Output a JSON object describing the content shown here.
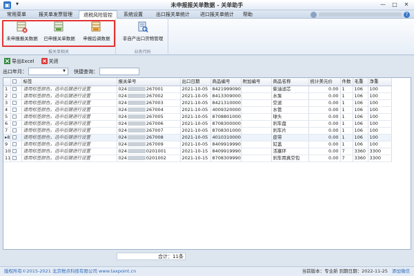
{
  "window": {
    "title": "未申报报关单数据 - 关单助手",
    "quick_access": "▾",
    "buttons": {
      "minimize": "—",
      "maximize": "□",
      "close": "✕"
    }
  },
  "menu": {
    "items": [
      "常用菜单",
      "报关单发票管理",
      "退税风险管控",
      "系统设置",
      "出口报关单统计",
      "进口报关单统计",
      "帮助"
    ],
    "active_index": 2,
    "help_glyph": "?"
  },
  "ribbon": {
    "group1": {
      "label": "报关单相关",
      "buttons": [
        {
          "label": "未申报报关数据",
          "icon": "grid-x-icon"
        },
        {
          "label": "已申报关单数据",
          "icon": "grid-check-icon"
        },
        {
          "label": "申报后调数据",
          "icon": "grid-return-icon"
        }
      ]
    },
    "group2": {
      "label": "业务代码",
      "buttons": [
        {
          "label": "非自产出口货物管理",
          "icon": "search-doc-icon"
        }
      ]
    }
  },
  "toolbar": {
    "export_label": "导出Excel",
    "close_label": "关闭"
  },
  "filter": {
    "month_label": "出口年月：",
    "month_value": "",
    "query_label": "快捷查询：",
    "query_value": ""
  },
  "table": {
    "columns": [
      "",
      "",
      "标签",
      "报关单号",
      "出口日期",
      "商品编号",
      "附加编号",
      "商品名称",
      "统计美元价",
      "件数",
      "毛重",
      "净重"
    ],
    "rows": [
      [
        "1",
        "",
        "请用标签颜色，选中后键进行设置",
        "024",
        "267001",
        "2021-10-05",
        "8421999090",
        "",
        "柴油滤芯",
        "0.00",
        "1",
        "106",
        "100"
      ],
      [
        "2",
        "",
        "请用标签颜色，选中后键进行设置",
        "024",
        "267002",
        "2021-10-05",
        "8413309000",
        "",
        "水泵",
        "0.00",
        "1",
        "106",
        "100"
      ],
      [
        "3",
        "",
        "请用标签颜色，选中后键进行设置",
        "024",
        "267003",
        "2021-10-05",
        "8421310000",
        "",
        "空滤",
        "0.00",
        "1",
        "106",
        "100"
      ],
      [
        "4",
        "",
        "请用标签颜色，选中后键进行设置",
        "024",
        "267004",
        "2021-10-05",
        "4009320000",
        "",
        "水管",
        "0.00",
        "1",
        "106",
        "100"
      ],
      [
        "5",
        "",
        "请用标签颜色，选中后键进行设置",
        "024",
        "267005",
        "2021-10-05",
        "8708801000",
        "",
        "球头",
        "0.00",
        "1",
        "106",
        "100"
      ],
      [
        "6",
        "",
        "请用标签颜色，选中后键进行设置",
        "024",
        "267006",
        "2021-10-05",
        "8708300000",
        "",
        "刹车盘",
        "0.00",
        "1",
        "106",
        "100"
      ],
      [
        "7",
        "",
        "请用标签颜色，选中后键进行设置",
        "024",
        "267007",
        "2021-10-05",
        "8708301000",
        "",
        "刹车片",
        "0.00",
        "1",
        "106",
        "100"
      ],
      [
        "8",
        "",
        "请用标签颜色，选中后键进行设置",
        "024",
        "267008",
        "2021-10-05",
        "4010310000",
        "",
        "皮带",
        "0.00",
        "1",
        "106",
        "100"
      ],
      [
        "9",
        "",
        "请用标签颜色，选中后键进行设置",
        "024",
        "267009",
        "2021-10-05",
        "8409919990",
        "",
        "缸盖",
        "0.00",
        "1",
        "106",
        "100"
      ],
      [
        "10",
        "",
        "请用标签颜色，选中后键进行设置",
        "024",
        "0201001",
        "2021-10-15",
        "8409919990",
        "",
        "活塞环",
        "0.00",
        "7",
        "3360",
        "3300"
      ],
      [
        "11",
        "",
        "请用标签颜色，选中后键进行设置",
        "024",
        "0201002",
        "2021-10-15",
        "8708309990",
        "",
        "刹车用真空包",
        "0.00",
        "7",
        "3360",
        "3300"
      ]
    ],
    "current_row_marker": "▸",
    "current_row_index": 7
  },
  "footer": {
    "sum_label": "合计：11条"
  },
  "status": {
    "copyright": "版权所有©2015-2021 北京税点科技有限公司 www.taxpoint.cn",
    "version": "当前版本：专业新",
    "expiry": "到期日期：2022-11-25",
    "wechat": "添加微信"
  }
}
